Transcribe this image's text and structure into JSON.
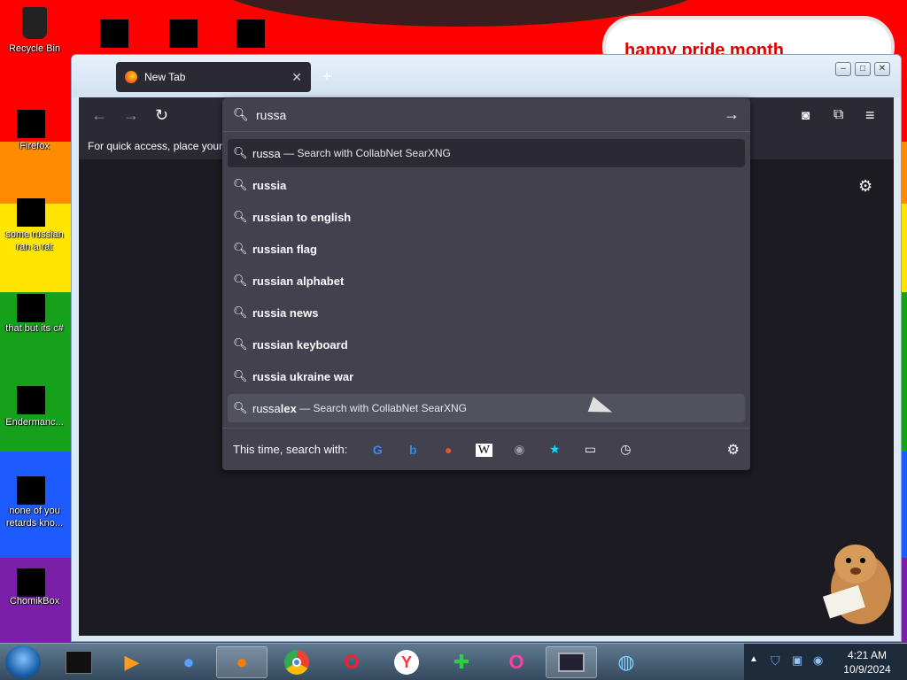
{
  "desktop": {
    "banner_text": "happy pride month",
    "icons": [
      {
        "label": "Recycle Bin",
        "icon": "recycle-bin-icon"
      },
      {
        "label": "Firefox",
        "icon": "firefox-icon"
      },
      {
        "label": "some russian ran a rat",
        "icon": "file-icon"
      },
      {
        "label": "that but its c#",
        "icon": "file-icon"
      },
      {
        "label": "Endermanc...",
        "icon": "app-icon"
      },
      {
        "label": "none of you retards kno...",
        "icon": "opera-icon"
      },
      {
        "label": "ChomikBox",
        "icon": "chomikbox-icon"
      }
    ]
  },
  "browser": {
    "tab_title": "New Tab",
    "bookmarks_hint": "For quick access, place your b",
    "urlbar_value": "russa",
    "results": [
      {
        "prefix": "russa",
        "bold": "",
        "action": "Search with CollabNet SearXNG",
        "state": "selected"
      },
      {
        "prefix": "",
        "bold": "russia",
        "action": "",
        "state": ""
      },
      {
        "prefix": "",
        "bold": "russian to english",
        "action": "",
        "state": ""
      },
      {
        "prefix": "",
        "bold": "russian flag",
        "action": "",
        "state": ""
      },
      {
        "prefix": "",
        "bold": "russian alphabet",
        "action": "",
        "state": ""
      },
      {
        "prefix": "",
        "bold": "russia news",
        "action": "",
        "state": ""
      },
      {
        "prefix": "",
        "bold": "russian keyboard",
        "action": "",
        "state": ""
      },
      {
        "prefix": "",
        "bold": "russia ukraine war",
        "action": "",
        "state": ""
      },
      {
        "prefix": "russa",
        "bold": "lex",
        "action": "Search with CollabNet SearXNG",
        "state": "hover"
      }
    ],
    "oneoff_label": "This time, search with:",
    "engines": [
      "google",
      "bing",
      "duckduckgo",
      "wikipedia",
      "searxng",
      "bookmarks",
      "tabs",
      "history"
    ],
    "colors": {
      "accent": "#2b2a33",
      "panel": "#42414d"
    }
  },
  "taskbar": {
    "time": "4:21 AM",
    "date": "10/9/2024",
    "items": [
      "app",
      "media",
      "globe",
      "firefox",
      "chrome",
      "opera",
      "yandex",
      "installer",
      "opera-gx",
      "screen",
      "network"
    ]
  }
}
